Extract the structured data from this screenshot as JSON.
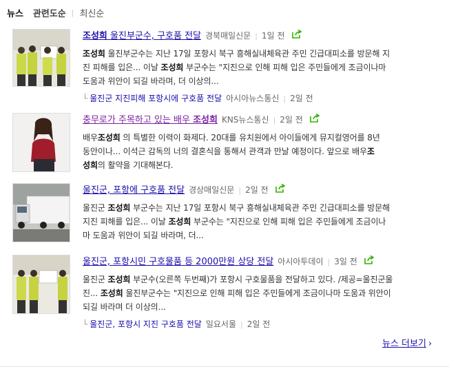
{
  "tabs": {
    "news": "뉴스",
    "related": "관련도순",
    "sep": "|",
    "latest": "최신순"
  },
  "items": [
    {
      "title_bold": "조성희",
      "title_rest": " 울진부군수, 구호품 전달",
      "press": "경북매일신문",
      "time": "1일 전",
      "desc_lines": [
        [
          "b:조성희",
          "t: 울진부군수는 지난 17일 포항시 북구 흥해실내체육관 주민 긴급대피소를 방문해 지"
        ],
        [
          "t:진 피해를 입은... 이날 ",
          "b:조성희",
          "t: 부군수는 \"지진으로 인해 피해 입은 주민들에게 조금이나마"
        ],
        [
          "t:도움과 위안이 되길 바라며, 더 이상의..."
        ]
      ],
      "related_title": "울진군 지진피해 포항시에 구호품 전달",
      "related_press": "아시아뉴스통신",
      "related_time": "2일 전"
    },
    {
      "title_rest": "충무로가 주목하고 있는 배우 ",
      "title_bold": "조성희",
      "press": "KNS뉴스통신",
      "time": "2일 전",
      "desc_lines": [
        [
          "t:배우",
          "b:조성희",
          "t: 의 특별한 이력이 화제다.  20대를 유치원에서 아이들에게 뮤지컬영어를 8년"
        ],
        [
          "t:동안이나... 이석근 감독의 너의 결혼식을 통해서 관객과 만날 예정이다.  앞으로 배우",
          "b:조"
        ],
        [
          "b:성희",
          "t:의 활약을 기대해본다."
        ]
      ]
    },
    {
      "title_rest": "울진군, 포항에 구호품 전달",
      "press": "경상매일신문",
      "time": "2일 전",
      "desc_lines": [
        [
          "t:울진군 ",
          "b:조성희",
          "t: 부군수는 지난 17일 포항시 북구 흥해실내체육관 주민 긴급대피소를 방문해"
        ],
        [
          "t:지진 피해를 입은... 이날 ",
          "b:조성희",
          "t: 부군수는 \"지진으로 인해 피해 입은 주민들에게 조금이나"
        ],
        [
          "t:마 도움과 위안이 되길 바라며, 더..."
        ]
      ]
    },
    {
      "title_rest": "울진군, 포항시민 구호물품 등 2000만원 상당 전달",
      "press": "아시아투데이",
      "time": "3일 전",
      "desc_lines": [
        [
          "t:울진군 ",
          "b:조성희",
          "t: 부군수(오른쪽 두번째)가 포항시 구호물품을 전달하고 있다. /제공=울진군울"
        ],
        [
          "t:진... ",
          "b:조성희",
          "t: 울진부군수는 \"지진으로 인해 피해 입은 주민들에게 조금이나마 도움과 위안이"
        ],
        [
          "t:되길 바라며 더 이상의..."
        ]
      ],
      "related_title": "울진군, 포항시 지진 구호품 전달",
      "related_press": "일요서울",
      "related_time": "2일 전"
    }
  ],
  "more": {
    "label": "뉴스 더보기",
    "chevron": "›"
  },
  "icons": {
    "share": "share-icon",
    "related_arrow": "└"
  },
  "colors": {
    "link": "#1a0dab",
    "visited": "#7b1fa2",
    "share_green": "#2db400"
  }
}
